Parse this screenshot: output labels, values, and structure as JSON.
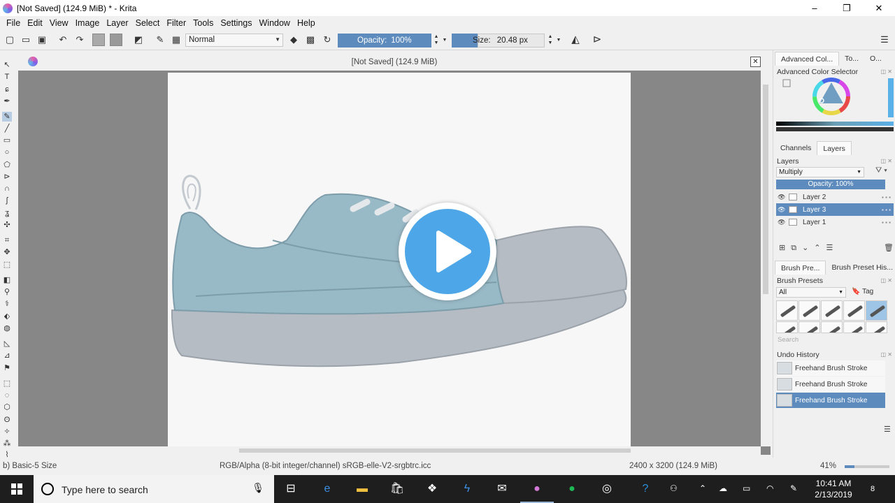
{
  "window": {
    "title": "[Not Saved]  (124.9 MiB) * - Krita",
    "minimize": "–",
    "restore": "❐",
    "close": "✕"
  },
  "menu": [
    "File",
    "Edit",
    "View",
    "Image",
    "Layer",
    "Select",
    "Filter",
    "Tools",
    "Settings",
    "Window",
    "Help"
  ],
  "toolbar": {
    "blend_mode": "Normal",
    "opacity_label": "Opacity:",
    "opacity_value": "100%",
    "size_label": "Size:",
    "size_value": "20.48 px"
  },
  "document": {
    "header_title": "[Not Saved]  (124.9 MiB)",
    "close": "✕"
  },
  "dock": {
    "top_tabs": [
      "Advanced Col...",
      "To...",
      "O..."
    ],
    "color_selector_title": "Advanced Color Selector",
    "layer_tabs": [
      "Channels",
      "Layers"
    ],
    "layers_title": "Layers",
    "layers_blend": "Multiply",
    "layers_opacity": "Opacity:  100%",
    "layers": [
      {
        "name": "Layer 2",
        "active": false
      },
      {
        "name": "Layer 3",
        "active": true
      },
      {
        "name": "Layer 1",
        "active": false
      }
    ],
    "brush_tabs": [
      "Brush Pre...",
      "Brush Preset His..."
    ],
    "brush_presets_title": "Brush Presets",
    "brush_filter": "All",
    "brush_tag": "Tag",
    "brush_search_placeholder": "Search",
    "undo_title": "Undo History",
    "undo_items": [
      "Freehand Brush Stroke",
      "Freehand Brush Stroke",
      "Freehand Brush Stroke"
    ]
  },
  "status": {
    "brush": "b) Basic-5 Size",
    "color_space": "RGB/Alpha (8-bit integer/channel)  sRGB-elle-V2-srgbtrc.icc",
    "dimensions": "2400 x 3200 (124.9 MiB)",
    "zoom": "41%"
  },
  "taskbar": {
    "search_placeholder": "Type here to search",
    "time": "10:41 AM",
    "date": "2/13/2019",
    "notifications": "8"
  },
  "colors": {
    "accent": "#5d8bbd",
    "shoe_upper": "#98b9c6",
    "shoe_sole": "#b6bcc3",
    "play": "#4da6e8"
  }
}
